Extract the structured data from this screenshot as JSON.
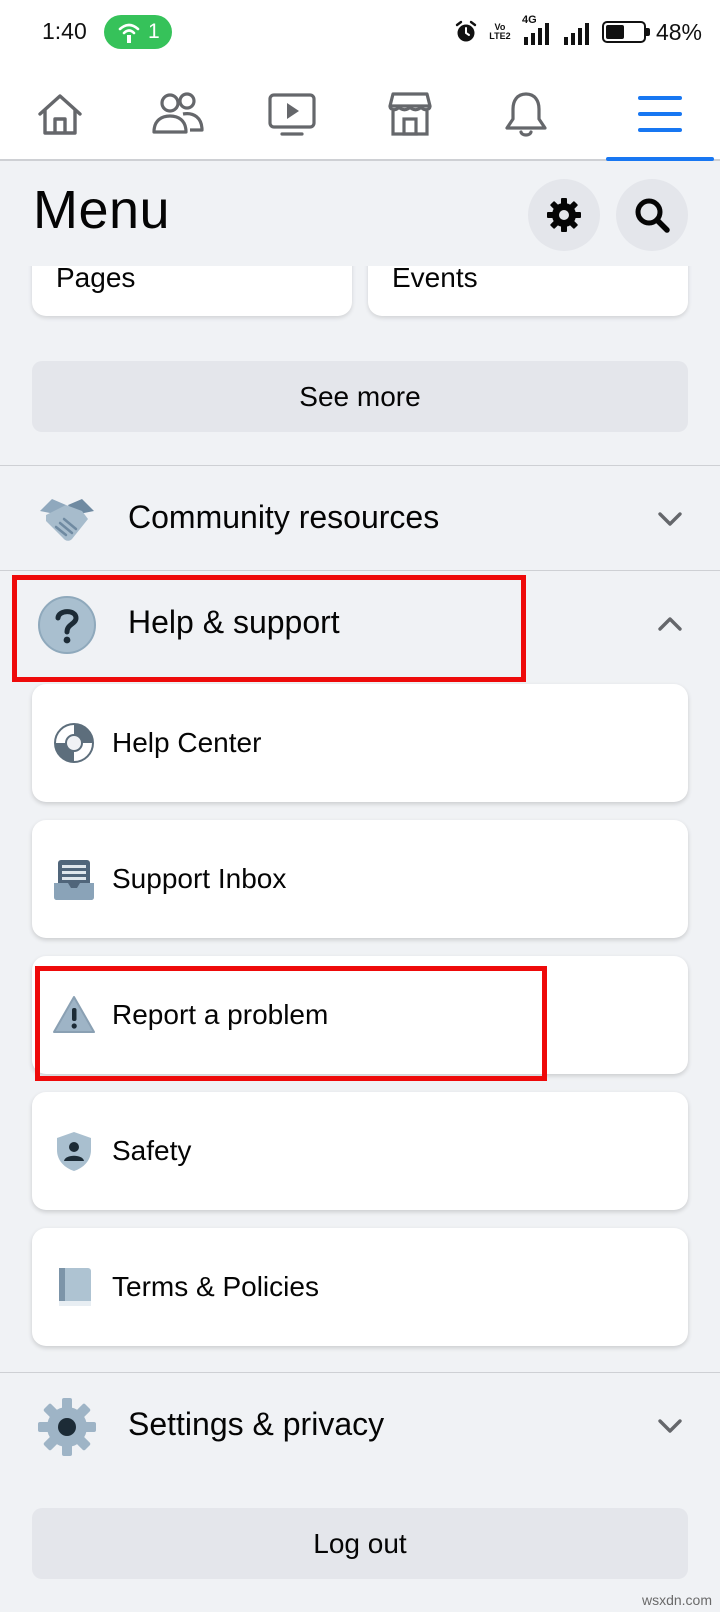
{
  "status_bar": {
    "time": "1:40",
    "hotspot_count": "1",
    "volte_label": "Vo LTE2",
    "network": "4G",
    "battery": "48%",
    "battery_level": 0.48
  },
  "nav": {
    "tabs": [
      {
        "icon": "home-icon"
      },
      {
        "icon": "friends-icon"
      },
      {
        "icon": "watch-icon"
      },
      {
        "icon": "marketplace-icon"
      },
      {
        "icon": "notifications-icon"
      },
      {
        "icon": "menu-icon",
        "active": true
      }
    ],
    "accent_color": "#1877f2"
  },
  "header": {
    "title": "Menu",
    "settings_icon": "gear-icon",
    "search_icon": "search-icon"
  },
  "shortcuts": [
    {
      "label": "Pages"
    },
    {
      "label": "Events"
    }
  ],
  "see_more_label": "See more",
  "sections": {
    "community": {
      "label": "Community resources",
      "icon": "handshake-icon",
      "expanded": false
    },
    "help": {
      "label": "Help & support",
      "icon": "question-icon",
      "expanded": true
    },
    "settings": {
      "label": "Settings & privacy",
      "icon": "gear-icon",
      "expanded": false
    }
  },
  "help_items": [
    {
      "label": "Help Center",
      "icon": "lifebuoy-icon"
    },
    {
      "label": "Support Inbox",
      "icon": "inbox-icon"
    },
    {
      "label": "Report a problem",
      "icon": "warning-icon"
    },
    {
      "label": "Safety",
      "icon": "shield-icon"
    },
    {
      "label": "Terms & Policies",
      "icon": "book-icon"
    }
  ],
  "logout_label": "Log out",
  "highlight_color": "#ee0a0a",
  "watermark": "wsxdn.com"
}
